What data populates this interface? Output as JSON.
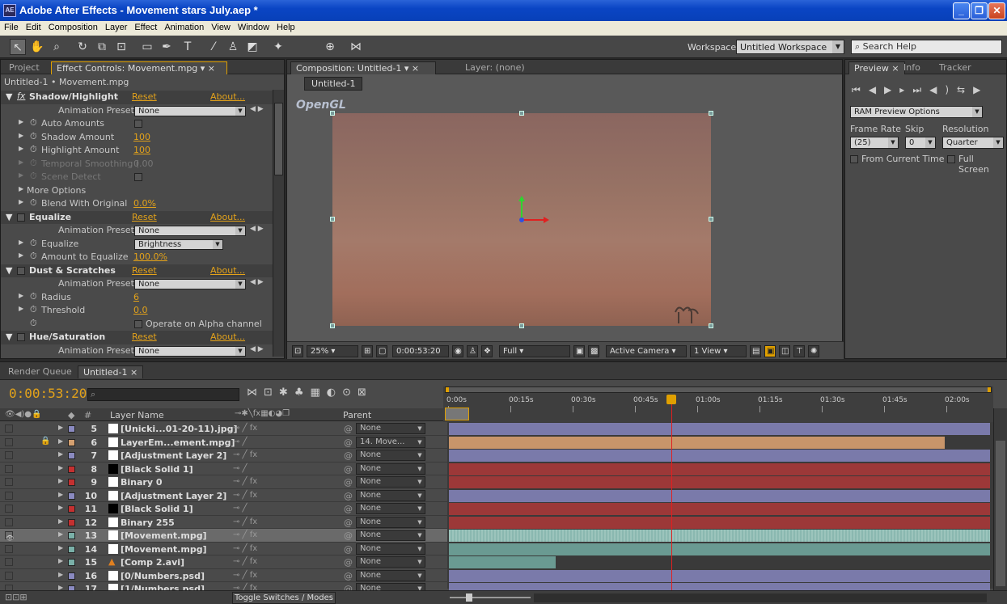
{
  "window": {
    "title": "Adobe After Effects - Movement stars July.aep *",
    "logo": "AE",
    "controls": [
      "minimize-icon",
      "maximize-icon",
      "close-icon"
    ]
  },
  "menu": [
    "File",
    "Edit",
    "Composition",
    "Layer",
    "Effect",
    "Animation",
    "View",
    "Window",
    "Help"
  ],
  "toolbar": {
    "workspace_label": "Workspace:",
    "workspace_value": "Untitled Workspace",
    "search_placeholder": "Search Help"
  },
  "left_panel": {
    "tabs": [
      "Project",
      "Effect Controls: Movement.mpg"
    ],
    "subtitle": "Untitled-1 • Movement.mpg",
    "effects": [
      {
        "name": "Shadow/Highlight",
        "reset": "Reset",
        "about": "About...",
        "presets_label": "Animation Presets:",
        "presets_value": "None"
      },
      {
        "name": "Equalize",
        "reset": "Reset",
        "about": "About...",
        "presets_label": "Animation Presets:",
        "presets_value": "None"
      },
      {
        "name": "Dust & Scratches",
        "reset": "Reset",
        "about": "About...",
        "presets_label": "Animation Presets:",
        "presets_value": "None"
      },
      {
        "name": "Hue/Saturation",
        "reset": "Reset",
        "about": "About...",
        "presets_label": "Animation Presets:",
        "presets_value": "None"
      }
    ],
    "props": {
      "auto_amounts": "Auto Amounts",
      "shadow_amount": "Shadow Amount",
      "shadow_amount_v": "100",
      "highlight_amount": "Highlight Amount",
      "highlight_amount_v": "100",
      "temporal": "Temporal Smoothing (",
      "temporal_v": "0.00",
      "scene": "Scene Detect",
      "more": "More Options",
      "blend": "Blend With Original",
      "blend_v": "0.0%",
      "equalize": "Equalize",
      "equalize_v": "Brightness",
      "amount_eq": "Amount to Equalize",
      "amount_eq_v": "100.0%",
      "radius": "Radius",
      "radius_v": "6",
      "threshold": "Threshold",
      "threshold_v": "0.0",
      "alpha": "Operate on Alpha channel"
    }
  },
  "comp_panel": {
    "tab": "Composition: Untitled-1",
    "layer_tab": "Layer: (none)",
    "comp_button": "Untitled-1",
    "renderer": "OpenGL",
    "zoom": "25%",
    "timecode": "0:00:53:20",
    "resolution": "Full",
    "camera": "Active Camera",
    "view": "1 View"
  },
  "right_panel": {
    "tabs": [
      "Preview",
      "Info",
      "Tracker"
    ],
    "ram": "RAM Preview Options",
    "frame_rate_label": "Frame Rate",
    "skip_label": "Skip",
    "resolution_label": "Resolution",
    "frame_rate": "(25)",
    "skip": "0",
    "resolution": "Quarter",
    "from_current": "From Current Time",
    "full_screen": "Full Screen"
  },
  "timeline": {
    "tabs": [
      "Render Queue",
      "Untitled-1"
    ],
    "timecode": "0:00:53:20",
    "layer_name_header": "Layer Name",
    "parent_header": "Parent",
    "toggle": "Toggle Switches / Modes",
    "ruler": [
      "0:00s",
      "00:15s",
      "00:30s",
      "00:45s",
      "01:00s",
      "01:15s",
      "01:30s",
      "01:45s",
      "02:00s"
    ],
    "layers": [
      {
        "num": "5",
        "name": "[Unicki...01-20-11).jpg]",
        "color": "#8a8ac0",
        "parent": "None",
        "bar": "#7a7aaa"
      },
      {
        "num": "6",
        "name": "LayerEm...ement.mpg]",
        "color": "#d4a070",
        "parent": "14. Move...",
        "bar": "#c8956a"
      },
      {
        "num": "7",
        "name": "[Adjustment Layer 2]",
        "color": "#8a8ac0",
        "parent": "None",
        "bar": "#7a7aaa"
      },
      {
        "num": "8",
        "name": "[Black Solid 1]",
        "color": "#c43030",
        "parent": "None",
        "bar": "#9c3838"
      },
      {
        "num": "9",
        "name": "Binary 0",
        "color": "#c43030",
        "parent": "None",
        "bar": "#9c3838"
      },
      {
        "num": "10",
        "name": "[Adjustment Layer 2]",
        "color": "#8a8ac0",
        "parent": "None",
        "bar": "#7a7aaa"
      },
      {
        "num": "11",
        "name": "[Black Solid 1]",
        "color": "#c43030",
        "parent": "None",
        "bar": "#9c3838"
      },
      {
        "num": "12",
        "name": "Binary 255",
        "color": "#c43030",
        "parent": "None",
        "bar": "#9c3838"
      },
      {
        "num": "13",
        "name": "[Movement.mpg]",
        "color": "#7ab0a8",
        "parent": "None",
        "bar": "#8ab8b0"
      },
      {
        "num": "14",
        "name": "[Movement.mpg]",
        "color": "#7ab0a8",
        "parent": "None",
        "bar": "#6a9a92"
      },
      {
        "num": "15",
        "name": "[Comp 2.avi]",
        "color": "#7ab0a8",
        "parent": "None",
        "bar": "#6a9a92"
      },
      {
        "num": "16",
        "name": "[0/Numbers.psd]",
        "color": "#8a8ac0",
        "parent": "None",
        "bar": "#7a7aaa"
      },
      {
        "num": "17",
        "name": "[1/Numbers.psd]",
        "color": "#8a8ac0",
        "parent": "None",
        "bar": "#7a7aaa"
      }
    ]
  }
}
